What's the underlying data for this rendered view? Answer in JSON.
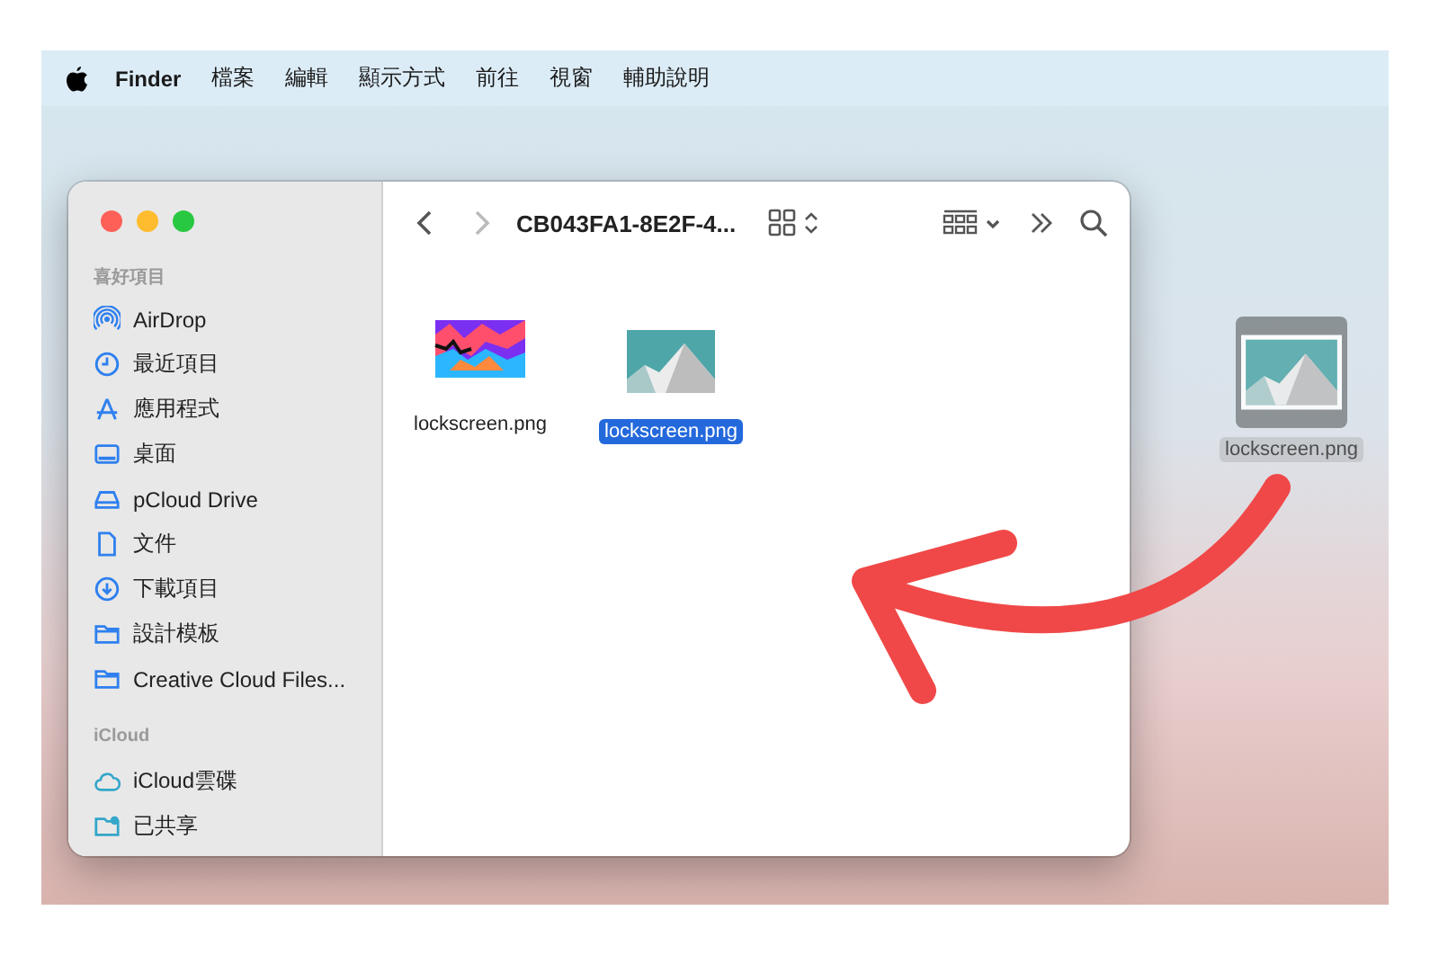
{
  "menu_bar": {
    "app": "Finder",
    "menus": [
      "檔案",
      "編輯",
      "顯示方式",
      "前往",
      "視窗",
      "輔助說明"
    ]
  },
  "finder_window": {
    "sidebar": {
      "sections": [
        {
          "title": "喜好項目",
          "items": [
            {
              "label": "AirDrop",
              "kind": "airdrop"
            },
            {
              "label": "最近項目",
              "kind": "clock"
            },
            {
              "label": "應用程式",
              "kind": "apps"
            },
            {
              "label": "桌面",
              "kind": "desktop"
            },
            {
              "label": "pCloud Drive",
              "kind": "drive"
            },
            {
              "label": "文件",
              "kind": "doc"
            },
            {
              "label": "下載項目",
              "kind": "download"
            },
            {
              "label": "設計模板",
              "kind": "folder"
            },
            {
              "label": "Creative Cloud Files...",
              "kind": "folder"
            }
          ]
        },
        {
          "title": "iCloud",
          "items": [
            {
              "label": "iCloud雲碟",
              "kind": "cloud"
            },
            {
              "label": "已共享",
              "kind": "shared"
            }
          ]
        }
      ]
    },
    "toolbar": {
      "title": "CB043FA1-8E2F-4..."
    },
    "files": [
      {
        "name": "lockscreen.png",
        "kind": "colorful",
        "selected": false
      },
      {
        "name": "lockscreen.png",
        "kind": "mountain",
        "selected": true
      }
    ]
  },
  "desktop_file": {
    "name": "lockscreen.png",
    "selected": true
  }
}
